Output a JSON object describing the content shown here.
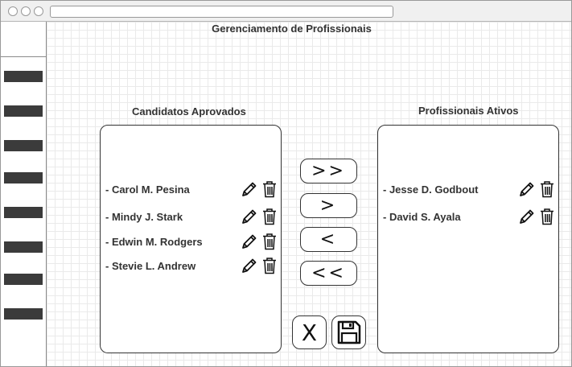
{
  "page": {
    "title": "Gerenciamento de Profissionais"
  },
  "left_panel": {
    "title": "Candidatos Aprovados",
    "items": [
      {
        "label": "- Carol M. Pesina"
      },
      {
        "label": "- Mindy J. Stark"
      },
      {
        "label": "- Edwin M. Rodgers"
      },
      {
        "label": "- Stevie L. Andrew"
      }
    ]
  },
  "right_panel": {
    "title": "Profissionais Ativos",
    "items": [
      {
        "label": "- Jesse D. Godbout"
      },
      {
        "label": "- David S. Ayala"
      }
    ]
  },
  "transfer_buttons": {
    "move_all_right": ">>",
    "move_right": ">",
    "move_left": "<",
    "move_all_left": "<<"
  },
  "action_buttons": {
    "cancel": "X"
  },
  "sidebar": {
    "item_count": 8
  },
  "icons": {
    "edit": "pencil-icon",
    "delete": "trash-icon",
    "save": "floppy-disk-icon"
  },
  "colors": {
    "border": "#333333",
    "sidebar_item": "#3b3b3b",
    "grid": "#eaeaea"
  }
}
